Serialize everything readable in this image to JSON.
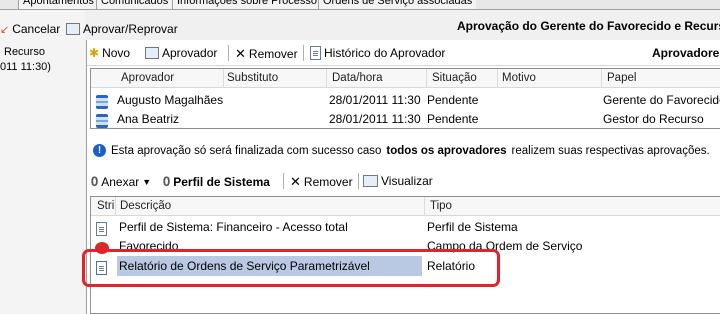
{
  "tabs": [
    "Apontamentos",
    "Comunicados",
    "Informações sobre Processo",
    "Ordens de Serviço associadas"
  ],
  "left": {
    "cancel_label": "Cancelar",
    "approve_label": "Aprovar/Reprovar",
    "item_line1": "Recurso",
    "item_line2": "011 11:30)"
  },
  "header": {
    "title": "Aprovação do Gerente do Favorecido e Recurso"
  },
  "approvers_toolbar": {
    "new_label": "Novo",
    "approver_label": "Aprovador",
    "remove_label": "Remover",
    "history_label": "Histórico do Aprovador",
    "section_title": "Aprovadores"
  },
  "approvers_grid": {
    "columns": [
      "Aprovador",
      "Substituto",
      "Data/hora",
      "Situação",
      "Motivo",
      "Papel"
    ],
    "rows": [
      {
        "aprovador": "Augusto Magalhães",
        "substituto": "",
        "data": "28/01/2011 11:30",
        "situacao": "Pendente",
        "motivo": "",
        "papel": "Gerente do Favorecido"
      },
      {
        "aprovador": "Ana Beatriz",
        "substituto": "",
        "data": "28/01/2011 11:30",
        "situacao": "Pendente",
        "motivo": "",
        "papel": "Gestor do Recurso"
      }
    ]
  },
  "info": {
    "before": "Esta aprovação só será finalizada com sucesso caso",
    "bold": "todos os aprovadores",
    "after": "realizem suas respectivas aprovações."
  },
  "attach_toolbar": {
    "attach_label": "Anexar",
    "profile_label": "Perfil de Sistema",
    "remove_label": "Remover",
    "view_label": "Visualizar"
  },
  "attachments_grid": {
    "columns": [
      "Stri",
      "Descrição",
      "Tipo"
    ],
    "rows": [
      {
        "descricao": "Perfil de Sistema: Financeiro - Acesso total",
        "tipo": "Perfil de Sistema",
        "icon": "document-icon"
      },
      {
        "descricao": "Favorecido",
        "tipo": "Campo da Ordem de Serviço",
        "icon": "red-record-icon"
      },
      {
        "descricao": "Relatório de Ordens de Serviço Parametrizável",
        "tipo": "Relatório",
        "icon": "report-icon"
      }
    ]
  },
  "colors": {
    "highlight": "#e3222b",
    "selection": "#b9c8e3",
    "info": "#1c5fc8"
  }
}
